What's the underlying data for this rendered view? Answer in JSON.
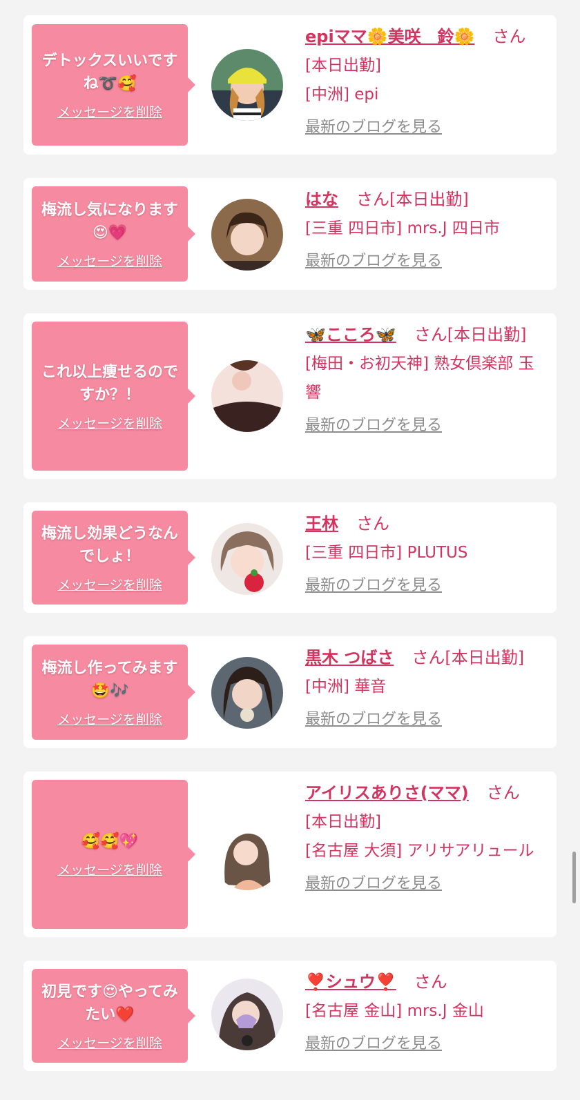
{
  "items": [
    {
      "message": "デトックスいいですね➰🥰",
      "delete_label": "メッセージを削除",
      "name": "epiママ🌼美咲　鈴🌼",
      "san": "さん",
      "lines": [
        "[本日出勤]",
        "[中洲] epi"
      ],
      "blog_label": "最新のブログを見る"
    },
    {
      "message": "梅流し気になります😍💗",
      "delete_label": "メッセージを削除",
      "name": "はな",
      "san": "さん[本日出勤]",
      "lines": [
        "[三重 四日市] mrs.J 四日市"
      ],
      "blog_label": "最新のブログを見る"
    },
    {
      "message": "これ以上痩せるのですか？！",
      "delete_label": "メッセージを削除",
      "name": "🦋こころ🦋",
      "san": "さん[本日出勤]",
      "lines": [
        "[梅田・お初天神] 熟女倶楽部 玉響"
      ],
      "blog_label": "最新のブログを見る"
    },
    {
      "message": "梅流し効果どうなんでしょ！",
      "delete_label": "メッセージを削除",
      "name": "王林",
      "san": "さん",
      "lines": [
        "[三重 四日市] PLUTUS"
      ],
      "blog_label": "最新のブログを見る"
    },
    {
      "message": "梅流し作ってみます🤩🎶",
      "delete_label": "メッセージを削除",
      "name": "黒木 つばさ",
      "san": "さん[本日出勤]",
      "lines": [
        "[中洲] 華音"
      ],
      "blog_label": "最新のブログを見る"
    },
    {
      "message": "🥰🥰💖",
      "delete_label": "メッセージを削除",
      "name": "アイリスありさ(ママ)",
      "san": "さん",
      "lines": [
        "[本日出勤]",
        "[名古屋 大須] アリサアリュール"
      ],
      "blog_label": "最新のブログを見る"
    },
    {
      "message": "初見です😍やってみたい❤️",
      "delete_label": "メッセージを削除",
      "name": "❣️シュウ❣️",
      "san": "さん",
      "lines": [
        "[名古屋 金山] mrs.J 金山"
      ],
      "blog_label": "最新のブログを見る"
    }
  ],
  "colors": {
    "accent": "#d2335f",
    "bubble": "#f58aa0",
    "link_gray": "#8d8d8d",
    "background": "#f3f3f3"
  }
}
